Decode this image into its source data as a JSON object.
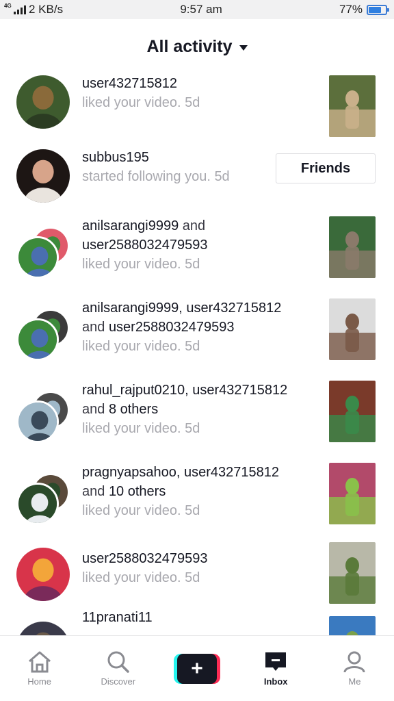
{
  "status_bar": {
    "network_tag": "4G",
    "speed": "2 KB/s",
    "time": "9:57 am",
    "battery": "77%",
    "battery_level": 0.77
  },
  "header": {
    "title": "All activity"
  },
  "activities": [
    {
      "names": [
        {
          "text": "user432715812",
          "bold": true
        }
      ],
      "action": "liked your video. 5d",
      "avatar_type": "single",
      "avatar_colors": [
        "#3e5b2e",
        "#8a6a3a",
        "#2b3c22"
      ],
      "thumb_colors": [
        "#c9b08a",
        "#5c6f3c"
      ]
    },
    {
      "names": [
        {
          "text": "subbus195",
          "bold": true
        }
      ],
      "action": "started following you. 5d",
      "avatar_type": "single",
      "avatar_colors": [
        "#1d1614",
        "#d7a48a",
        "#e9e4de"
      ],
      "button": "Friends"
    },
    {
      "names": [
        {
          "text": "anilsarangi9999",
          "bold": true
        },
        {
          "text": " and",
          "bold": false
        },
        {
          "text": "\nuser2588032479593",
          "bold": true
        }
      ],
      "action": "liked your video. 5d",
      "avatar_type": "stack",
      "avatar_colors": [
        "#e05a6a",
        "#3c8a3a",
        "#4a6fb0"
      ],
      "thumb_colors": [
        "#8a7a6a",
        "#3a6a3a"
      ]
    },
    {
      "names": [
        {
          "text": "anilsarangi9999, user432715812",
          "bold": true
        },
        {
          "text": "\nand ",
          "bold": false
        },
        {
          "text": "user2588032479593",
          "bold": true
        }
      ],
      "action": "liked your video. 5d",
      "avatar_type": "stack",
      "avatar_colors": [
        "#3b3b3b",
        "#3c8a3a",
        "#4a6fb0"
      ],
      "thumb_colors": [
        "#7a5a48",
        "#dcdcdc"
      ]
    },
    {
      "names": [
        {
          "text": "rahul_rajput0210, user432715812",
          "bold": true
        },
        {
          "text": "\nand ",
          "bold": false
        },
        {
          "text": "8 others",
          "bold": true
        }
      ],
      "action": "liked your video. 5d",
      "avatar_type": "stack",
      "avatar_colors": [
        "#4a4a4a",
        "#9fb8c8",
        "#3a4a5a"
      ],
      "thumb_colors": [
        "#3a8a4a",
        "#7a3a2a"
      ]
    },
    {
      "names": [
        {
          "text": "pragnyapsahoo, user432715812",
          "bold": true
        },
        {
          "text": "\nand ",
          "bold": false
        },
        {
          "text": "10 others",
          "bold": true
        }
      ],
      "action": "liked your video. 5d",
      "avatar_type": "stack",
      "avatar_colors": [
        "#5a4a3a",
        "#2a4a2a",
        "#e8ecef"
      ],
      "thumb_colors": [
        "#8ac04a",
        "#b24a6a"
      ]
    },
    {
      "names": [
        {
          "text": "user2588032479593",
          "bold": true
        }
      ],
      "action": "liked your video. 5d",
      "avatar_type": "single",
      "avatar_colors": [
        "#d8344a",
        "#f3a53a",
        "#7a2a5a"
      ],
      "thumb_colors": [
        "#5a7a3a",
        "#b8b8a8"
      ]
    },
    {
      "names": [
        {
          "text": "11pranati11",
          "bold": true
        }
      ],
      "action": "",
      "avatar_type": "single",
      "avatar_colors": [
        "#3a3a4a",
        "#6a5a4a",
        "#2a2a3a"
      ],
      "thumb_colors": [
        "#7aa04a",
        "#3a7ac0"
      ]
    }
  ],
  "nav": [
    {
      "label": "Home",
      "icon": "home-icon",
      "active": false
    },
    {
      "label": "Discover",
      "icon": "search-icon",
      "active": false
    },
    {
      "label": "",
      "icon": "plus-icon",
      "active": false
    },
    {
      "label": "Inbox",
      "icon": "inbox-icon",
      "active": true
    },
    {
      "label": "Me",
      "icon": "profile-icon",
      "active": false
    }
  ]
}
